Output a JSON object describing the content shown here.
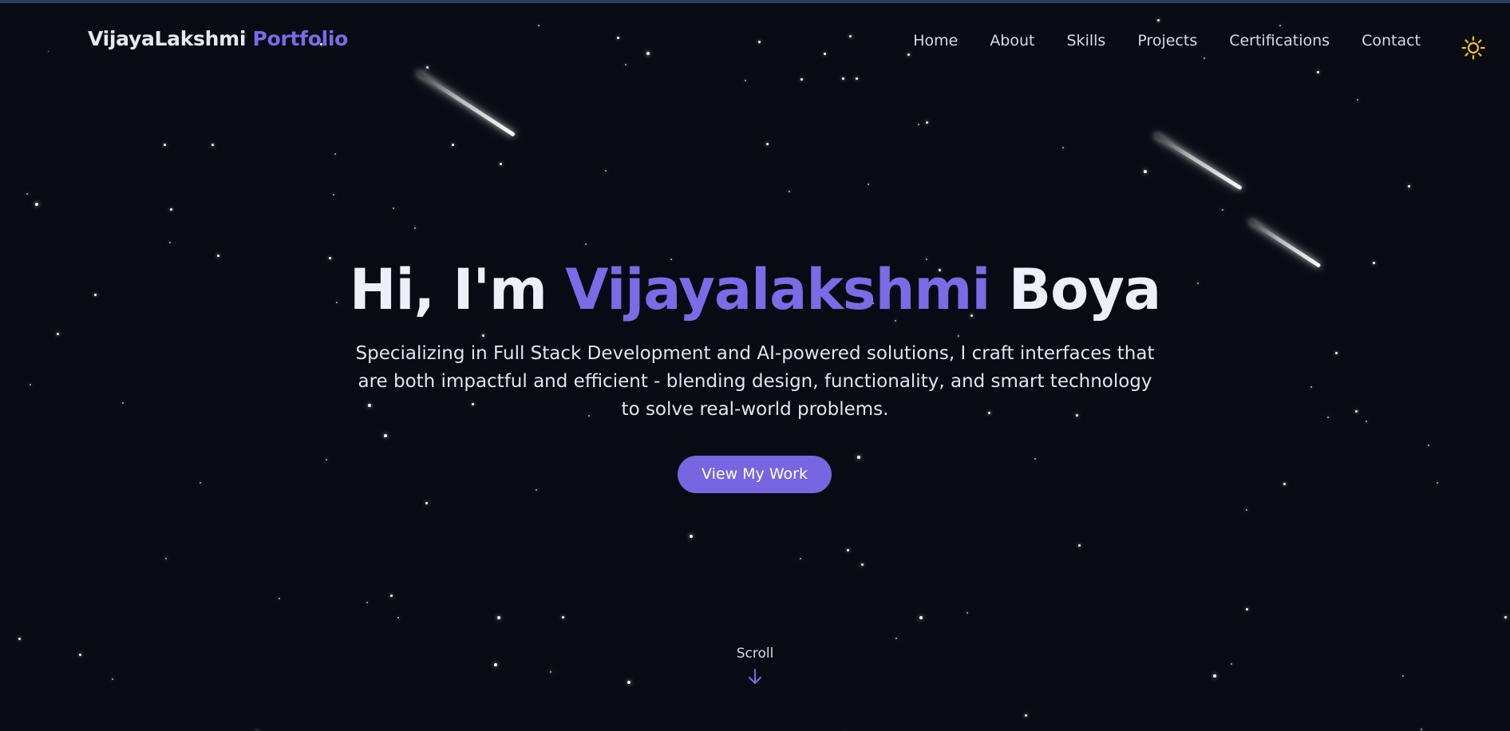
{
  "nav": {
    "logo_main": "VijayaLakshmi",
    "logo_accent": "Portfolio",
    "links": [
      "Home",
      "About",
      "Skills",
      "Projects",
      "Certifications",
      "Contact"
    ],
    "theme_toggle_icon": "sun-icon"
  },
  "hero": {
    "greeting": "Hi, I'm",
    "first_name": "Vijayalakshmi",
    "last_name": "Boya",
    "subtitle": "Specializing in Full Stack Development and AI-powered solutions, I craft interfaces that are both impactful and efficient - blending design, functionality, and smart technology to solve real-world problems.",
    "cta_label": "View My Work",
    "scroll_label": "Scroll",
    "scroll_icon": "arrow-down-icon"
  },
  "colors": {
    "background": "#080b13",
    "accent": "#7c6ae6",
    "button": "#7766e0",
    "text": "#eef0f7",
    "sun": "#f5c518"
  }
}
